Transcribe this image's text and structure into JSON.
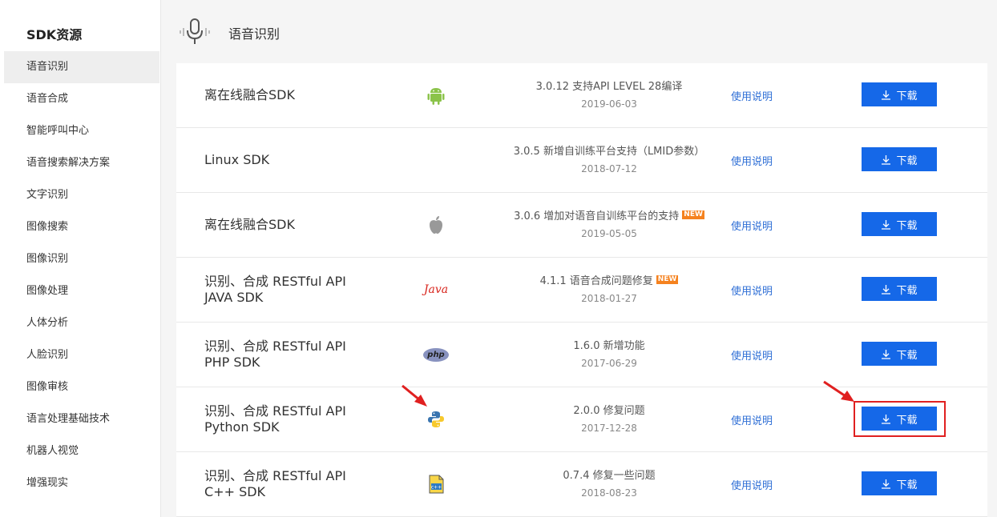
{
  "sidebar": {
    "title": "SDK资源",
    "items": [
      {
        "label": "语音识别",
        "active": true
      },
      {
        "label": "语音合成"
      },
      {
        "label": "智能呼叫中心"
      },
      {
        "label": "语音搜索解决方案"
      },
      {
        "label": "文字识别"
      },
      {
        "label": "图像搜索"
      },
      {
        "label": "图像识别"
      },
      {
        "label": "图像处理"
      },
      {
        "label": "人体分析"
      },
      {
        "label": "人脸识别"
      },
      {
        "label": "图像审核"
      },
      {
        "label": "语言处理基础技术"
      },
      {
        "label": "机器人视觉"
      },
      {
        "label": "增强现实"
      }
    ]
  },
  "header": {
    "title": "语音识别",
    "icon": "microphone-icon"
  },
  "rows": [
    {
      "name": "离在线融合SDK",
      "platform": "android-icon",
      "version": "3.0.12 支持API LEVEL 28编译",
      "date": "2019-06-03",
      "new": "",
      "doc": "使用说明",
      "download": "下载"
    },
    {
      "name": "Linux SDK",
      "platform": "",
      "version": "3.0.5 新增自训练平台支持（LMID参数）",
      "date": "2018-07-12",
      "new": "",
      "doc": "使用说明",
      "download": "下载"
    },
    {
      "name": "离在线融合SDK",
      "platform": "apple-icon",
      "version": "3.0.6 增加对语音自训练平台的支持",
      "date": "2019-05-05",
      "new": "NEW",
      "doc": "使用说明",
      "download": "下载"
    },
    {
      "name": "识别、合成 RESTful API",
      "name2": "JAVA SDK",
      "platform": "java-icon",
      "platform_text": "Java",
      "version": "4.1.1 语音合成问题修复",
      "date": "2018-01-27",
      "new": "NEW",
      "doc": "使用说明",
      "download": "下载"
    },
    {
      "name": "识别、合成 RESTful API",
      "name2": "PHP SDK",
      "platform": "php-icon",
      "platform_text": "php",
      "version": "1.6.0 新增功能",
      "date": "2017-06-29",
      "new": "",
      "doc": "使用说明",
      "download": "下载"
    },
    {
      "name": "识别、合成 RESTful API",
      "name2": "Python SDK",
      "platform": "python-icon",
      "version": "2.0.0 修复问题",
      "date": "2017-12-28",
      "new": "",
      "doc": "使用说明",
      "download": "下载"
    },
    {
      "name": "识别、合成 RESTful API",
      "name2": "C++ SDK",
      "platform": "cpp-icon",
      "version": "0.7.4 修复一些问题",
      "date": "2018-08-23",
      "new": "",
      "doc": "使用说明",
      "download": "下载"
    }
  ],
  "colors": {
    "accent": "#1568e8",
    "link": "#2f6fd6",
    "badge": "#f5821f",
    "annotation": "#e02020"
  }
}
